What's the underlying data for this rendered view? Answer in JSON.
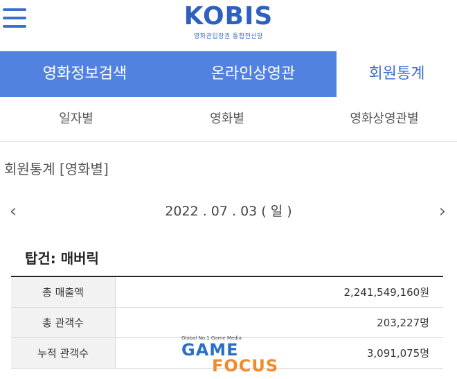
{
  "header": {
    "logo": "KOBIS",
    "logo_sub": "영화관입장권 통합전산망"
  },
  "nav": {
    "tabs": [
      {
        "label": "영화정보검색"
      },
      {
        "label": "온라인상영관"
      },
      {
        "label": "회원통계"
      }
    ]
  },
  "subnav": {
    "items": [
      {
        "label": "일자별"
      },
      {
        "label": "영화별"
      },
      {
        "label": "영화상영관별"
      }
    ]
  },
  "section": {
    "title": "회원통계 [영화별]"
  },
  "date_nav": {
    "prev": "‹",
    "date": "2022 . 07 . 03 ( 일 )",
    "next": "›"
  },
  "movie": {
    "title": "탑건: 매버릭"
  },
  "stats": {
    "rows": [
      {
        "label": "총 매출액",
        "value": "2,241,549,160원"
      },
      {
        "label": "총 관객수",
        "value": "203,227명"
      },
      {
        "label": "누적 관객수",
        "value": "3,091,075명"
      }
    ]
  },
  "watermark": {
    "top": "Global No.1 Game Media",
    "game": "GAME",
    "focus": "FOCUS"
  },
  "colors": {
    "brand_blue": "#2f60bf",
    "nav_blue": "#5282e0",
    "active_text": "#3e6fd1"
  }
}
